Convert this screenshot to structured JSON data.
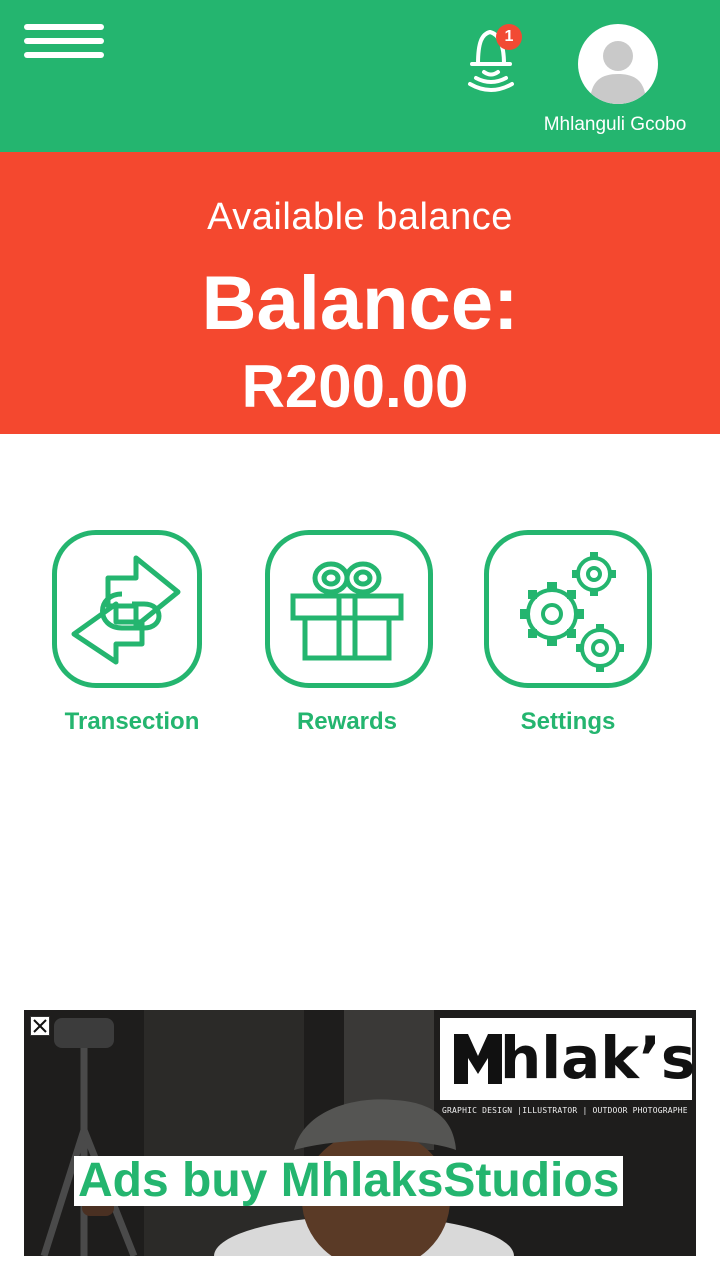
{
  "header": {
    "notification_count": "1",
    "user_name": "Mhlanguli Gcobo"
  },
  "balance": {
    "caption": "Available balance",
    "title": "Balance:",
    "amount": "R200.00"
  },
  "tiles": [
    {
      "label": "Transection",
      "icon": "transfer-arrows-icon"
    },
    {
      "label": "Rewards",
      "icon": "gift-icon"
    },
    {
      "label": "Settings",
      "icon": "gears-icon"
    }
  ],
  "ad": {
    "logo_text": "hlak’s",
    "tagline": "GRAPHIC DESIGN |ILLUSTRATOR | OUTDOOR PHOTOGRAPHE",
    "headline": "Ads buy MhlaksStudios"
  },
  "colors": {
    "brand_green": "#24b56f",
    "balance_red": "#f4482f"
  }
}
